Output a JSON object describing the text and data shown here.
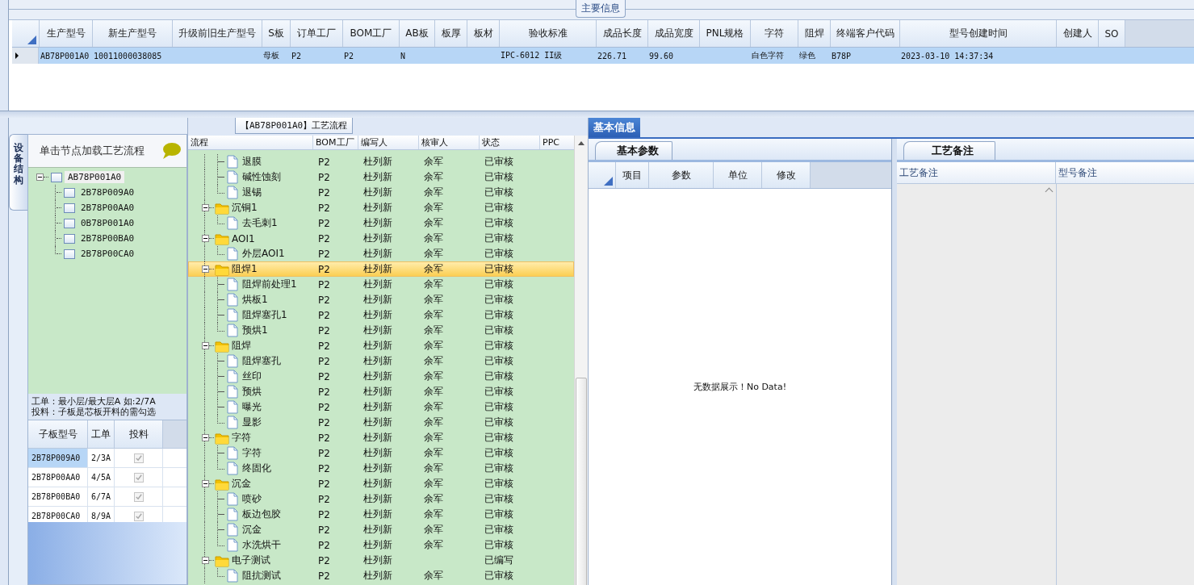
{
  "main_info": {
    "title": "主要信息",
    "row_selected": true,
    "columns": [
      {
        "label": "生产型号",
        "value": "AB78P001A0"
      },
      {
        "label": "新生产型号",
        "value": "10011000038085"
      },
      {
        "label": "升级前旧生产型号"
      },
      {
        "label": "S板",
        "value": "母板"
      },
      {
        "label": "订单工厂",
        "value": "P2"
      },
      {
        "label": "BOM工厂",
        "value": "P2"
      },
      {
        "label": "AB板",
        "value": "N"
      },
      {
        "label": "板厚"
      },
      {
        "label": "板材"
      },
      {
        "label": "验收标准",
        "value": "IPC-6012 II级"
      },
      {
        "label": "成品长度",
        "value": "226.71"
      },
      {
        "label": "成品宽度",
        "value": "99.60"
      },
      {
        "label": "PNL规格"
      },
      {
        "label": "字符",
        "value": "白色字符"
      },
      {
        "label": "阻焊",
        "value": "绿色"
      },
      {
        "label": "终端客户代码",
        "value": "B78P"
      },
      {
        "label": "型号创建时间",
        "value": "2023-03-10 14:37:34"
      },
      {
        "label": "创建人"
      },
      {
        "label": "SO"
      }
    ]
  },
  "structure": {
    "side_tab": "设备结构",
    "header": "单击节点加载工艺流程",
    "tree": {
      "label": "AB78P001A0",
      "expanded": true,
      "selected": true,
      "children": [
        {
          "label": "2B78P009A0"
        },
        {
          "label": "2B78P00AA0"
        },
        {
          "label": "0B78P001A0"
        },
        {
          "label": "2B78P00BA0"
        },
        {
          "label": "2B78P00CA0"
        }
      ]
    },
    "notes": [
      "工单：最小层/最大层A 如:2/7A",
      "投料：子板是芯板开料的需勾选"
    ],
    "sub_table": {
      "columns": [
        "子板型号",
        "工单",
        "投料"
      ],
      "rows": [
        {
          "model": "2B78P009A0",
          "work_order": "2/3A",
          "feed": true,
          "selected": true
        },
        {
          "model": "2B78P00AA0",
          "work_order": "4/5A",
          "feed": true,
          "selected": false
        },
        {
          "model": "2B78P00BA0",
          "work_order": "6/7A",
          "feed": true,
          "selected": false
        },
        {
          "model": "2B78P00CA0",
          "work_order": "8/9A",
          "feed": true,
          "selected": false
        }
      ]
    }
  },
  "flow": {
    "title": "【AB78P001A0】工艺流程",
    "columns": [
      "流程",
      "BOM工厂",
      "编写人",
      "核审人",
      "状态",
      "PPC"
    ],
    "groups": [
      {
        "kind": "continued",
        "children": [
          {
            "name": "退膜",
            "bom": "P2",
            "writer": "杜列新",
            "reviewer": "余军",
            "status": "已审核"
          },
          {
            "name": "碱性蚀刻",
            "bom": "P2",
            "writer": "杜列新",
            "reviewer": "余军",
            "status": "已审核"
          },
          {
            "name": "退锡",
            "bom": "P2",
            "writer": "杜列新",
            "reviewer": "余军",
            "status": "已审核"
          }
        ]
      },
      {
        "kind": "folder",
        "name": "沉铜1",
        "bom": "P2",
        "writer": "杜列新",
        "reviewer": "余军",
        "status": "已审核",
        "expanded": true,
        "selected": false,
        "children": [
          {
            "name": "去毛刺1",
            "bom": "P2",
            "writer": "杜列新",
            "reviewer": "余军",
            "status": "已审核"
          }
        ]
      },
      {
        "kind": "folder",
        "name": "AOI1",
        "bom": "P2",
        "writer": "杜列新",
        "reviewer": "余军",
        "status": "已审核",
        "expanded": true,
        "selected": false,
        "children": [
          {
            "name": "外层AOI1",
            "bom": "P2",
            "writer": "杜列新",
            "reviewer": "余军",
            "status": "已审核"
          }
        ]
      },
      {
        "kind": "folder",
        "name": "阻焊1",
        "bom": "P2",
        "writer": "杜列新",
        "reviewer": "余军",
        "status": "已审核",
        "expanded": true,
        "selected": true,
        "children": [
          {
            "name": "阻焊前处理1",
            "bom": "P2",
            "writer": "杜列新",
            "reviewer": "余军",
            "status": "已审核"
          },
          {
            "name": "烘板1",
            "bom": "P2",
            "writer": "杜列新",
            "reviewer": "余军",
            "status": "已审核"
          },
          {
            "name": "阻焊塞孔1",
            "bom": "P2",
            "writer": "杜列新",
            "reviewer": "余军",
            "status": "已审核"
          },
          {
            "name": "预烘1",
            "bom": "P2",
            "writer": "杜列新",
            "reviewer": "余军",
            "status": "已审核"
          }
        ]
      },
      {
        "kind": "folder",
        "name": "阻焊",
        "bom": "P2",
        "writer": "杜列新",
        "reviewer": "余军",
        "status": "已审核",
        "expanded": true,
        "selected": false,
        "children": [
          {
            "name": "阻焊塞孔",
            "bom": "P2",
            "writer": "杜列新",
            "reviewer": "余军",
            "status": "已审核"
          },
          {
            "name": "丝印",
            "bom": "P2",
            "writer": "杜列新",
            "reviewer": "余军",
            "status": "已审核"
          },
          {
            "name": "预烘",
            "bom": "P2",
            "writer": "杜列新",
            "reviewer": "余军",
            "status": "已审核"
          },
          {
            "name": "曝光",
            "bom": "P2",
            "writer": "杜列新",
            "reviewer": "余军",
            "status": "已审核"
          },
          {
            "name": "显影",
            "bom": "P2",
            "writer": "杜列新",
            "reviewer": "余军",
            "status": "已审核"
          }
        ]
      },
      {
        "kind": "folder",
        "name": "字符",
        "bom": "P2",
        "writer": "杜列新",
        "reviewer": "余军",
        "status": "已审核",
        "expanded": true,
        "selected": false,
        "children": [
          {
            "name": "字符",
            "bom": "P2",
            "writer": "杜列新",
            "reviewer": "余军",
            "status": "已审核"
          },
          {
            "name": "终固化",
            "bom": "P2",
            "writer": "杜列新",
            "reviewer": "余军",
            "status": "已审核"
          }
        ]
      },
      {
        "kind": "folder",
        "name": "沉金",
        "bom": "P2",
        "writer": "杜列新",
        "reviewer": "余军",
        "status": "已审核",
        "expanded": true,
        "selected": false,
        "children": [
          {
            "name": "喷砂",
            "bom": "P2",
            "writer": "杜列新",
            "reviewer": "余军",
            "status": "已审核"
          },
          {
            "name": "板边包胶",
            "bom": "P2",
            "writer": "杜列新",
            "reviewer": "余军",
            "status": "已审核"
          },
          {
            "name": "沉金",
            "bom": "P2",
            "writer": "杜列新",
            "reviewer": "余军",
            "status": "已审核"
          },
          {
            "name": "水洗烘干",
            "bom": "P2",
            "writer": "杜列新",
            "reviewer": "余军",
            "status": "已审核"
          }
        ]
      },
      {
        "kind": "folder",
        "name": "电子测试",
        "bom": "P2",
        "writer": "杜列新",
        "status": "已编写",
        "expanded": true,
        "selected": false,
        "children": [
          {
            "name": "阻抗测试",
            "bom": "P2",
            "writer": "杜列新",
            "reviewer": "余军",
            "status": "已审核"
          }
        ]
      }
    ]
  },
  "basic_info": {
    "tab": "基本信息",
    "params": {
      "tab": "基本参数",
      "columns": [
        "项目",
        "参数",
        "单位",
        "修改"
      ],
      "empty_message": "无数据展示！No Data!"
    },
    "remarks": {
      "tab": "工艺备注",
      "columns": [
        "工艺备注",
        "型号备注"
      ]
    }
  }
}
